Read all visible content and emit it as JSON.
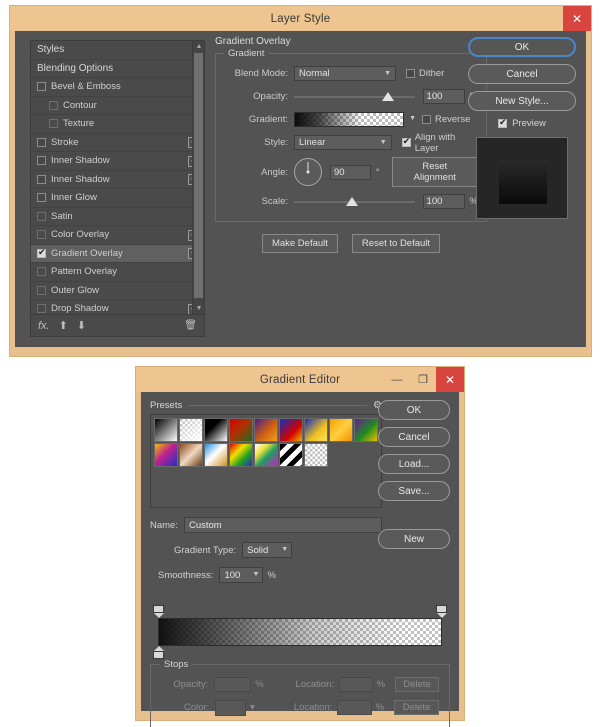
{
  "layer_style": {
    "title": "Layer Style",
    "close_icon": "close-icon",
    "styles_list": [
      {
        "label": "Styles",
        "type": "header"
      },
      {
        "label": "Blending Options",
        "type": "header"
      },
      {
        "label": "Bevel & Emboss",
        "type": "check",
        "checked": false,
        "indent": false,
        "plus": false
      },
      {
        "label": "Contour",
        "type": "check",
        "checked": false,
        "indent": true,
        "plus": false
      },
      {
        "label": "Texture",
        "type": "check",
        "checked": false,
        "indent": true,
        "plus": false
      },
      {
        "label": "Stroke",
        "type": "check",
        "checked": false,
        "indent": false,
        "plus": true
      },
      {
        "label": "Inner Shadow",
        "type": "check",
        "checked": false,
        "indent": false,
        "plus": true
      },
      {
        "label": "Inner Shadow",
        "type": "check",
        "checked": false,
        "indent": false,
        "plus": true
      },
      {
        "label": "Inner Glow",
        "type": "check",
        "checked": false,
        "indent": false,
        "plus": false
      },
      {
        "label": "Satin",
        "type": "check",
        "checked": false,
        "indent": false,
        "plus": false
      },
      {
        "label": "Color Overlay",
        "type": "check",
        "checked": false,
        "indent": false,
        "plus": true
      },
      {
        "label": "Gradient Overlay",
        "type": "check",
        "checked": true,
        "indent": false,
        "plus": true,
        "selected": true
      },
      {
        "label": "Pattern Overlay",
        "type": "check",
        "checked": false,
        "indent": false,
        "plus": false
      },
      {
        "label": "Outer Glow",
        "type": "check",
        "checked": false,
        "indent": false,
        "plus": false
      },
      {
        "label": "Drop Shadow",
        "type": "check",
        "checked": false,
        "indent": false,
        "plus": true
      }
    ],
    "footer_icons": [
      "fx-icon",
      "arrow-up-icon",
      "arrow-down-icon",
      "trash-icon"
    ],
    "section_title": "Gradient Overlay",
    "group_legend": "Gradient",
    "fields": {
      "blend_mode_label": "Blend Mode:",
      "blend_mode_value": "Normal",
      "dither_label": "Dither",
      "dither_checked": false,
      "opacity_label": "Opacity:",
      "opacity_value": "100",
      "opacity_unit": "%",
      "gradient_label": "Gradient:",
      "reverse_label": "Reverse",
      "reverse_checked": false,
      "style_label": "Style:",
      "style_value": "Linear",
      "align_label": "Align with Layer",
      "align_checked": true,
      "angle_label": "Angle:",
      "angle_value": "90",
      "angle_unit": "°",
      "reset_alignment_label": "Reset Alignment",
      "scale_label": "Scale:",
      "scale_value": "100",
      "scale_unit": "%"
    },
    "make_default_label": "Make Default",
    "reset_default_label": "Reset to Default",
    "ok_label": "OK",
    "cancel_label": "Cancel",
    "new_style_label": "New Style...",
    "preview_label": "Preview",
    "preview_checked": true
  },
  "gradient_editor": {
    "title": "Gradient Editor",
    "minimize_icon": "minimize-icon",
    "maximize_icon": "maximize-icon",
    "close_icon": "close-icon",
    "presets_label": "Presets",
    "gear_icon": "gear-icon",
    "presets": [
      "linear-gradient(135deg,#000 0%,#fff 100%)",
      "linear-gradient(135deg,rgba(255,255,255,0) 0%,#fff 100%), repeating-conic-gradient(#fff 0% 25%,#b9b9b9 0% 50%)",
      "linear-gradient(135deg,#000 0%,#fff 100%)",
      "linear-gradient(135deg,#d40000 0%,#c03000 45%,#1f6b1f 100%)",
      "linear-gradient(135deg,#4a1e8c 0%,#d06010 55%,#f0a020 100%)",
      "linear-gradient(135deg,#1030c0 0%,#d00000 60%,#f0b000 100%)",
      "linear-gradient(135deg,#1030c0 0%,#f0c020 60%,#ffe060 100%)",
      "linear-gradient(135deg,#f0a000 0%,#ffd040 50%,#f09000 100%)",
      "linear-gradient(135deg,#6a1b9a 0%,#1f8b1f 55%,#f0c000 100%)",
      "linear-gradient(135deg,#f0c000 0%,#c02090 45%,#2030c0 100%)",
      "linear-gradient(135deg,#8a4a1a 0%,#f0d8c0 50%,#6a3a10 100%)",
      "linear-gradient(135deg,#2090e0 0%,#ffffff 45%,#d09020 100%)",
      "linear-gradient(135deg,#e00000 0%,#f0e000 35%,#20a020 65%,#2030c0 100%)",
      "linear-gradient(135deg,#ffffff 0%,#f0e040 30%,#20a060 55%,#c020c0 100%)",
      "repeating-linear-gradient(135deg,#000 0 6px,#fff 6px 12px)",
      "repeating-conic-gradient(#fff 0% 25%,#c0c0c0 0% 50%)"
    ],
    "name_label": "Name:",
    "name_value": "Custom",
    "new_label": "New",
    "gradient_type_label": "Gradient Type:",
    "gradient_type_value": "Solid",
    "smoothness_label": "Smoothness:",
    "smoothness_value": "100",
    "smoothness_unit": "%",
    "ok_label": "OK",
    "cancel_label": "Cancel",
    "load_label": "Load...",
    "save_label": "Save...",
    "stops_legend": "Stops",
    "stops": {
      "opacity_label": "Opacity:",
      "opacity_value": "",
      "opacity_unit": "%",
      "location_label_1": "Location:",
      "location_value_1": "",
      "location_unit_1": "%",
      "delete_label_1": "Delete",
      "color_label": "Color:",
      "location_label_2": "Location:",
      "location_value_2": "",
      "location_unit_2": "%",
      "delete_label_2": "Delete"
    }
  },
  "colors": {
    "frame": "#e8c08d",
    "titlebar": "#eec590",
    "panel": "#535353",
    "accent_focus": "#4a86c8",
    "close_red": "#d8453f"
  }
}
